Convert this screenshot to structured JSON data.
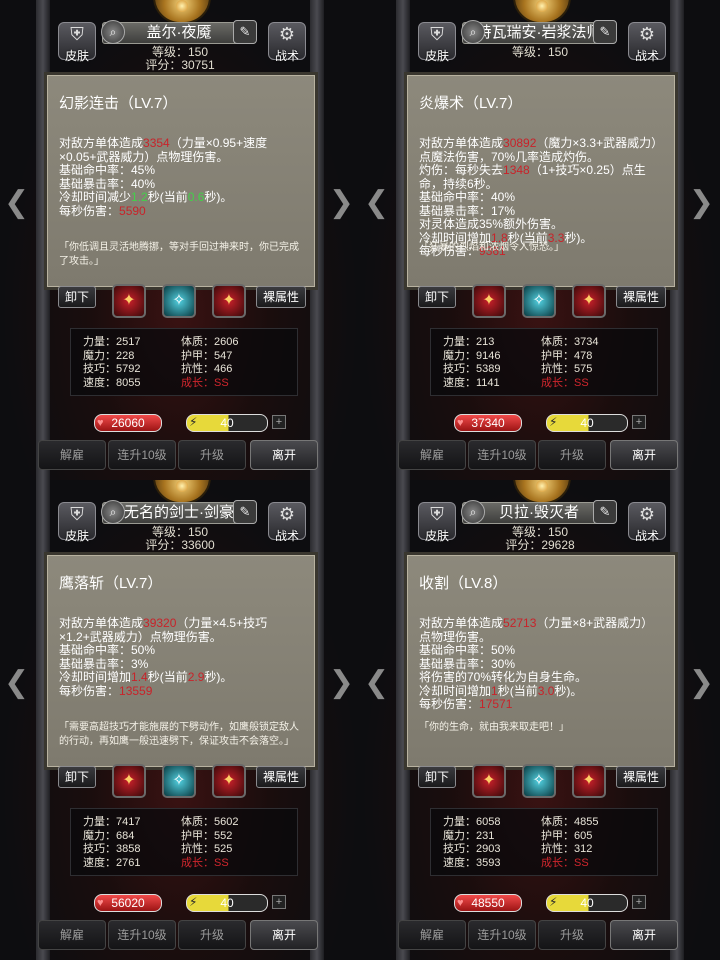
{
  "labels": {
    "skin": "皮肤",
    "tactics": "战术",
    "unequip": "卸下",
    "naked_attr": "裸属性",
    "dismiss": "解雇",
    "upgrade10": "连升10级",
    "upgrade": "升级",
    "leave": "离开"
  },
  "panels": [
    {
      "hero_name": "盖尔·夜魇",
      "level_text": "等级：150",
      "rating_text": "评分：30751",
      "skill": {
        "title": "幻影连击（LV.7）",
        "desc_pre": "对敌方单体造成",
        "damage": "3354",
        "desc_post": "（力量×0.95+速度×0.05+武器威力）点物理伤害。",
        "extra": "",
        "extra_value": "",
        "extra_post": "",
        "hit": "基础命中率：45%",
        "crit": "基础暴击率：40%",
        "extra2": "",
        "cd_pre": "冷却时间减少",
        "cd_value": "1.2",
        "cd_mid": "秒(当前",
        "cd_current": "0.6",
        "cd_post": "秒)。",
        "dps_label": "每秒伤害：",
        "dps": "5590",
        "quote": "「你低调且灵活地腾挪，等对手回过神来时，你已完成了攻击。」"
      },
      "stats": {
        "str": "力量：2517",
        "con": "体质：2606",
        "mag": "魔力：228",
        "arm": "护甲：547",
        "skl": "技巧：5792",
        "res": "抗性：466",
        "spd": "速度：8055",
        "growth": "成长：SS"
      },
      "hp": "26060",
      "energy": "40",
      "cd_color": "green"
    },
    {
      "hero_name": "特瓦瑞安·岩浆法师",
      "level_text": "等级：150",
      "rating_text": "",
      "skill": {
        "title": "炎爆术（LV.7）",
        "desc_pre": "对敌方单体造成",
        "damage": "30892",
        "desc_post": "（魔力×3.3+武器威力）点魔法伤害，70%几率造成灼伤。",
        "extra": "灼伤：每秒失去",
        "extra_value": "1348",
        "extra_post": "（1+技巧×0.25）点生命，持续6秒。",
        "hit": "基础命中率：40%",
        "crit": "基础暴击率：17%",
        "extra2": "对灵体造成35%额外伤害。",
        "cd_pre": "冷却时间增加",
        "cd_value": "1.8",
        "cd_mid": "秒(当前",
        "cd_current": "3.3",
        "cd_post": "秒)。",
        "dps_label": "每秒伤害：",
        "dps": "9361",
        "quote": "「狂暴的烈焰和浓烟令人惊恐。」"
      },
      "stats": {
        "str": "力量：213",
        "con": "体质：3734",
        "mag": "魔力：9146",
        "arm": "护甲：478",
        "skl": "技巧：5389",
        "res": "抗性：575",
        "spd": "速度：1141",
        "growth": "成长：SS"
      },
      "hp": "37340",
      "energy": "40",
      "cd_color": "red"
    },
    {
      "hero_name": "无名的剑士·剑豪",
      "level_text": "等级：150",
      "rating_text": "评分：33600",
      "skill": {
        "title": "鹰落斩（LV.7）",
        "desc_pre": "对敌方单体造成",
        "damage": "39320",
        "desc_post": "（力量×4.5+技巧×1.2+武器威力）点物理伤害。",
        "extra": "",
        "extra_value": "",
        "extra_post": "",
        "hit": "基础命中率：50%",
        "crit": "基础暴击率：3%",
        "extra2": "",
        "cd_pre": "冷却时间增加",
        "cd_value": "1.4",
        "cd_mid": "秒(当前",
        "cd_current": "2.9",
        "cd_post": "秒)。",
        "dps_label": "每秒伤害：",
        "dps": "13559",
        "quote": "「需要高超技巧才能施展的下劈动作，如鹰般锁定敌人的行动，再如鹰一般迅速劈下，保证攻击不会落空。」"
      },
      "stats": {
        "str": "力量：7417",
        "con": "体质：5602",
        "mag": "魔力：684",
        "arm": "护甲：552",
        "skl": "技巧：3858",
        "res": "抗性：525",
        "spd": "速度：2761",
        "growth": "成长：SS"
      },
      "hp": "56020",
      "energy": "40",
      "cd_color": "red"
    },
    {
      "hero_name": "贝拉·毁灭者",
      "level_text": "等级：150",
      "rating_text": "评分：29628",
      "skill": {
        "title": "收割（LV.8）",
        "desc_pre": "对敌方单体造成",
        "damage": "52713",
        "desc_post": "（力量×8+武器威力）点物理伤害。",
        "extra": "",
        "extra_value": "",
        "extra_post": "",
        "hit": "基础命中率：50%",
        "crit": "基础暴击率：30%",
        "extra2": "将伤害的70%转化为自身生命。",
        "cd_pre": "冷却时间增加",
        "cd_value": "1",
        "cd_mid": "秒(当前",
        "cd_current": "3.0",
        "cd_post": "秒)。",
        "dps_label": "每秒伤害：",
        "dps": "17571",
        "quote": "「你的生命，就由我来取走吧！」"
      },
      "stats": {
        "str": "力量：6058",
        "con": "体质：4855",
        "mag": "魔力：231",
        "arm": "护甲：605",
        "skl": "技巧：2903",
        "res": "抗性：312",
        "spd": "速度：3593",
        "growth": "成长：SS"
      },
      "hp": "48550",
      "energy": "40",
      "cd_color": "red"
    }
  ],
  "colors": {
    "damage_red": "#c8232a",
    "cd_green": "#43d04a",
    "growth_red": "#d0262d",
    "tooltip_bg": "#8d897c"
  },
  "icons": [
    "crest-icon",
    "skin-icon",
    "gear-icon",
    "edit-icon",
    "arrow-left-icon",
    "arrow-right-icon",
    "heart-icon",
    "bolt-icon",
    "plus-icon"
  ]
}
